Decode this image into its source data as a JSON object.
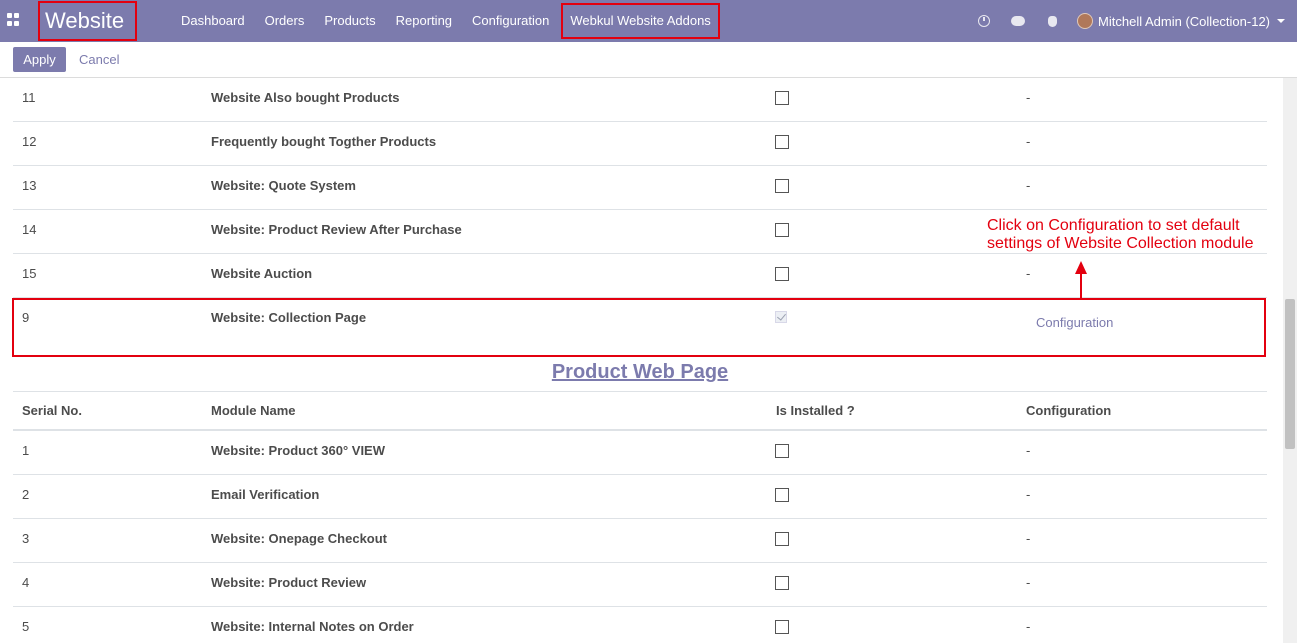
{
  "navbar": {
    "brand": "Website",
    "menu": [
      "Dashboard",
      "Orders",
      "Products",
      "Reporting",
      "Configuration",
      "Webkul Website Addons"
    ],
    "user": "Mitchell Admin (Collection-12)"
  },
  "control": {
    "apply": "Apply",
    "cancel": "Cancel"
  },
  "top_rows": [
    {
      "serial": "11",
      "name": "Website Also bought Products",
      "installed": false,
      "config": "-"
    },
    {
      "serial": "12",
      "name": "Frequently bought Togther Products",
      "installed": false,
      "config": "-"
    },
    {
      "serial": "13",
      "name": "Website: Quote System",
      "installed": false,
      "config": "-"
    },
    {
      "serial": "14",
      "name": "Website: Product Review After Purchase",
      "installed": false,
      "config": "-"
    },
    {
      "serial": "15",
      "name": "Website Auction",
      "installed": false,
      "config": "-"
    },
    {
      "serial": "9",
      "name": "Website: Collection Page",
      "installed": true,
      "config": "Configuration"
    }
  ],
  "annotation": {
    "line1": "Click on Configuration to set default",
    "line2": "settings of Website Collection module"
  },
  "section2": {
    "title": "Product Web Page",
    "headers": {
      "serial": "Serial No.",
      "name": "Module Name",
      "installed": "Is Installed ?",
      "config": "Configuration"
    },
    "rows": [
      {
        "serial": "1",
        "name": "Website: Product 360° VIEW",
        "installed": false,
        "config": "-"
      },
      {
        "serial": "2",
        "name": "Email Verification",
        "installed": false,
        "config": "-"
      },
      {
        "serial": "3",
        "name": "Website: Onepage Checkout",
        "installed": false,
        "config": "-"
      },
      {
        "serial": "4",
        "name": "Website: Product Review",
        "installed": false,
        "config": "-"
      },
      {
        "serial": "5",
        "name": "Website: Internal Notes on Order",
        "installed": false,
        "config": "-"
      }
    ]
  },
  "colors": {
    "navbar": "#7c7bad",
    "highlight": "#e3000f",
    "link": "#7c7bad"
  }
}
